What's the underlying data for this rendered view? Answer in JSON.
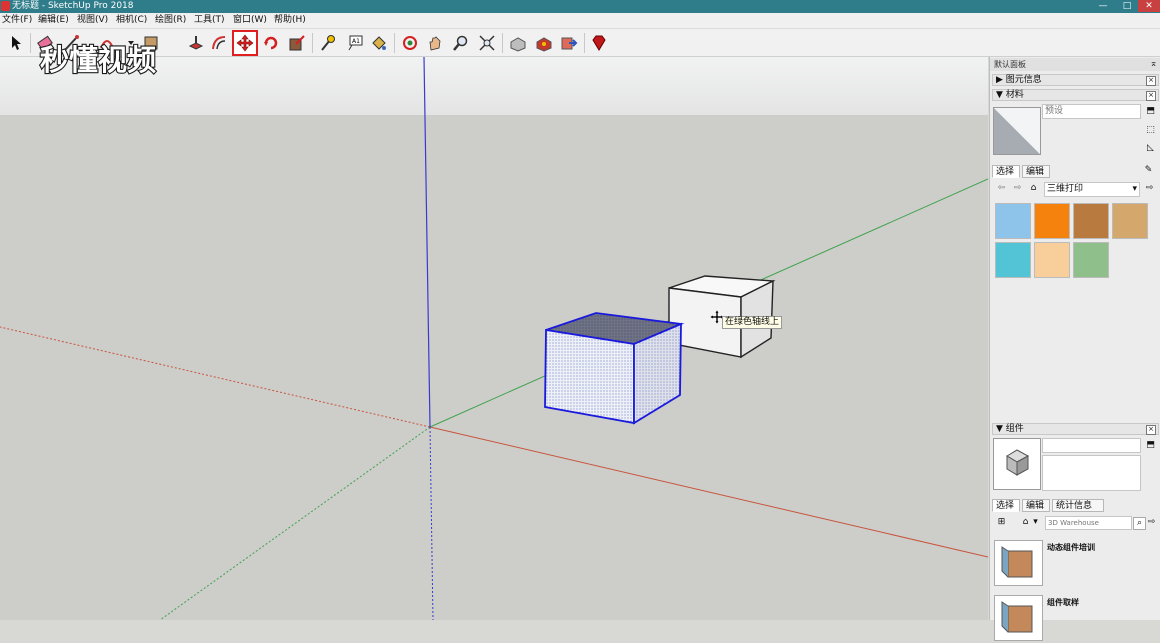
{
  "window": {
    "title": "无标题 - SketchUp Pro 2018",
    "controls": [
      "—",
      "□",
      "✕"
    ]
  },
  "menu": [
    "文件(F)",
    "编辑(E)",
    "视图(V)",
    "相机(C)",
    "绘图(R)",
    "工具(T)",
    "窗口(W)",
    "帮助(H)"
  ],
  "toolbar": {
    "tools": [
      "select-tool",
      "eraser-tool",
      "line-tool",
      "arc-tool",
      "shape-tool",
      "push-pull-tool",
      "offset-tool",
      "move-tool",
      "rotate-tool",
      "scale-tool",
      "tape-measure-tool",
      "text-tool",
      "paint-bucket-tool",
      "orbit-tool",
      "pan-tool",
      "zoom-tool",
      "zoom-extents-tool",
      "3d-warehouse-tool",
      "extension-warehouse-tool",
      "layout-tool",
      "ruby-tool"
    ],
    "active_tool": "move-tool",
    "active_highlight_color": "#e02020"
  },
  "watermark": "秒懂视频",
  "viewport": {
    "tooltip": "在绿色轴线上",
    "axis_colors": {
      "x": "#c8553d",
      "y": "#3fa34d",
      "z": "#3a3ad0"
    },
    "selection_color": "#1a1adc"
  },
  "tray": {
    "title": "默认面板",
    "entity_info": "图元信息",
    "materials": {
      "header": "材料",
      "name_placeholder": "预设",
      "tabs": [
        "选择",
        "编辑"
      ],
      "collection": "三维打印",
      "swatches": [
        "#8ec3ea",
        "#f5820c",
        "#b87a3f",
        "#d4a76c",
        "#53c4d6",
        "#f8cf9a",
        "#8fbf8a"
      ]
    },
    "components": {
      "header": "组件",
      "tabs": [
        "选择",
        "编辑",
        "统计信息"
      ],
      "search_placeholder": "3D Warehouse",
      "items": [
        "动态组件培训",
        "组件取样"
      ]
    }
  }
}
